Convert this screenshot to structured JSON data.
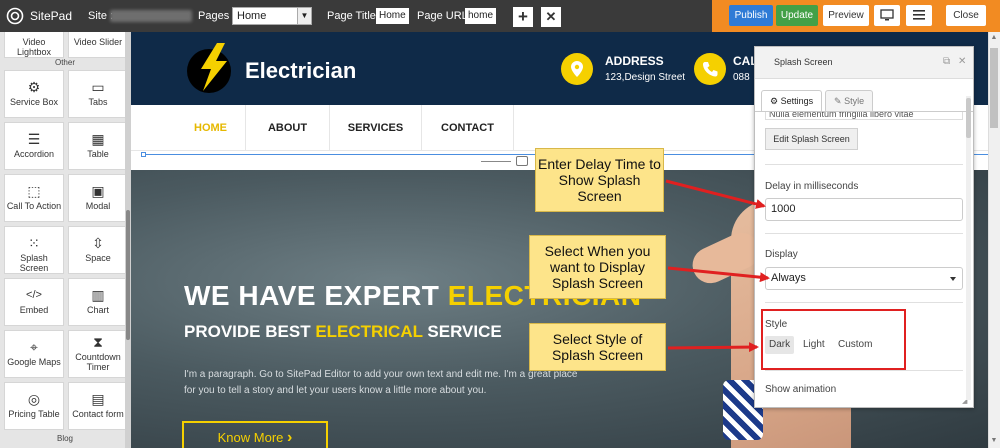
{
  "topbar": {
    "app_name": "SitePad",
    "site_label": "Site :",
    "pages_label": "Pages :",
    "pages_selected": "Home",
    "page_title_label": "Page Title:",
    "page_title_value": "Home",
    "page_url_label": "Page URL:",
    "page_url_value": "home",
    "add_icon": "+",
    "remove_icon": "✕",
    "buttons": {
      "publish": "Publish",
      "update": "Update",
      "preview": "Preview",
      "close": "Close"
    },
    "icons": [
      "desktop-icon",
      "menu-icon"
    ]
  },
  "sidebar": {
    "groups": {
      "other": "Other",
      "bottom": "Blog"
    },
    "tiles": [
      {
        "label": "Video Lightbox",
        "icon": "video-icon",
        "glyph": ""
      },
      {
        "label": "Video Slider",
        "icon": "video-slider-icon",
        "glyph": ""
      },
      {
        "label": "Service Box",
        "icon": "gear-icon",
        "glyph": "⚙"
      },
      {
        "label": "Tabs",
        "icon": "tabs-icon",
        "glyph": "▭"
      },
      {
        "label": "Accordion",
        "icon": "accordion-icon",
        "glyph": "☰"
      },
      {
        "label": "Table",
        "icon": "table-icon",
        "glyph": "▦"
      },
      {
        "label": "Call To Action",
        "icon": "cursor-icon",
        "glyph": "⬚"
      },
      {
        "label": "Modal",
        "icon": "modal-icon",
        "glyph": "▣"
      },
      {
        "label": "Splash Screen",
        "icon": "splash-icon",
        "glyph": "⁙"
      },
      {
        "label": "Space",
        "icon": "space-icon",
        "glyph": "⇳"
      },
      {
        "label": "Embed",
        "icon": "code-icon",
        "glyph": "</>"
      },
      {
        "label": "Chart",
        "icon": "chart-icon",
        "glyph": "▥"
      },
      {
        "label": "Google Maps",
        "icon": "map-icon",
        "glyph": "⌖"
      },
      {
        "label": "Countdown Timer",
        "icon": "hourglass-icon",
        "glyph": "⧗"
      },
      {
        "label": "Pricing Table",
        "icon": "pricing-icon",
        "glyph": "◎"
      },
      {
        "label": "Contact form",
        "icon": "form-icon",
        "glyph": "▤"
      }
    ]
  },
  "site": {
    "brand": "Electrician",
    "address_title": "ADDRESS",
    "address_text": "123,Design Street",
    "call_title": "CAL",
    "call_text": "088",
    "nav": [
      "HOME",
      "ABOUT",
      "SERVICES",
      "CONTACT"
    ],
    "hero_line1_white": "WE HAVE EXPERT ",
    "hero_line1_yellow": "ELECTRICIAN",
    "hero_line2_white_a": "PROVIDE BEST ",
    "hero_line2_yellow": "ELECTRICAL",
    "hero_line2_white_b": " SERVICE",
    "hero_paragraph": "I'm a paragraph. Go to SitePad Editor to add your own text and edit me. I'm a great place for you to tell a story and let your users know a little more about you.",
    "cta": "Know More",
    "cta_icon": "›"
  },
  "panel": {
    "title": "Splash Screen",
    "tabs": {
      "settings": "Settings",
      "style": "Style"
    },
    "cut_text": "Nulla elementum fringilla libero vitae",
    "edit_button": "Edit Splash Screen",
    "delay_label": "Delay in milliseconds",
    "delay_value": "1000",
    "display_label": "Display",
    "display_value": "Always",
    "style_label": "Style",
    "style_options": [
      "Dark",
      "Light",
      "Custom"
    ],
    "style_selected": "Dark",
    "next_label": "Show animation"
  },
  "callouts": {
    "delay": "Enter Delay Time to Show Splash Screen",
    "display": "Select When you want to Display Splash Screen",
    "style": "Select Style of Splash Screen"
  },
  "colors": {
    "accent_yellow": "#f5d000",
    "header_navy": "#0f2a48",
    "topbar": "#3a3a3a",
    "orange": "#f28b22",
    "publish_blue": "#2f7bd6",
    "update_green": "#43a047",
    "annotation_red": "#e02020"
  }
}
